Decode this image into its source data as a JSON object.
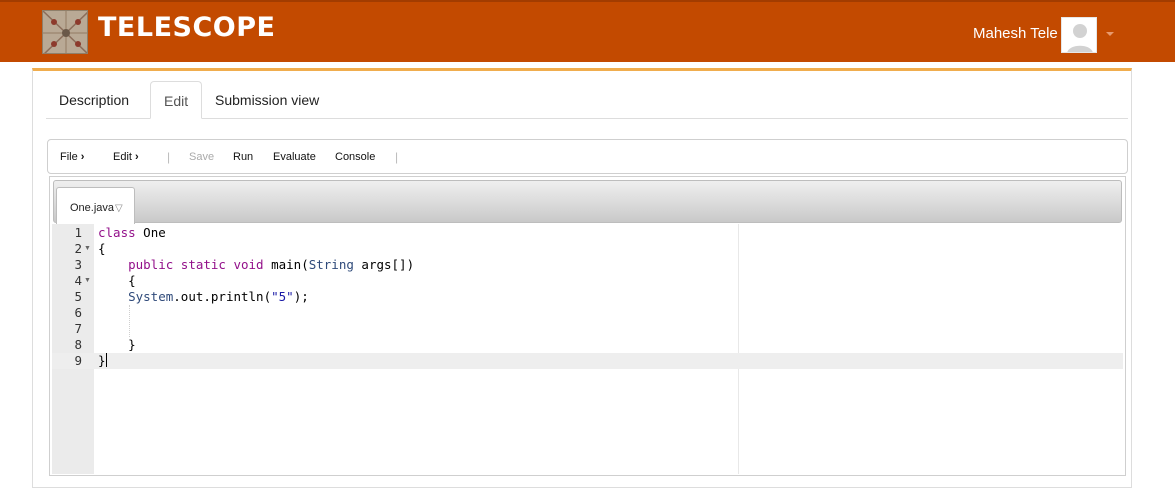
{
  "header": {
    "brand": "TELESCOPE",
    "user_name": "Mahesh Tele",
    "logo_icon": "telescope-logo-icon",
    "avatar_icon": "user-avatar-icon",
    "accent_color": "#c34a00"
  },
  "tabs": [
    {
      "label": "Description",
      "active": false
    },
    {
      "label": "Edit",
      "active": true
    },
    {
      "label": "Submission view",
      "active": false
    }
  ],
  "toolbar": {
    "file_label": "File",
    "edit_label": "Edit",
    "save_label": "Save",
    "run_label": "Run",
    "evaluate_label": "Evaluate",
    "console_label": "Console",
    "separator": "|"
  },
  "editor": {
    "file_tab": "One.java",
    "line_numbers": [
      "1",
      "2",
      "3",
      "4",
      "5",
      "6",
      "7",
      "8",
      "9"
    ],
    "code": {
      "l1_kw": "class",
      "l1_name": " One",
      "l2": "{",
      "l3_indent": "    ",
      "l3_kw": "public static void",
      "l3_method": " main(",
      "l3_type": "String",
      "l3_rest": " args[])",
      "l4": "    {",
      "l5_indent": "    ",
      "l5_type": "System",
      "l5_mid": ".out.println(",
      "l5_str": "\"5\"",
      "l5_end": ");",
      "l8": "    }",
      "l9": "}"
    }
  }
}
